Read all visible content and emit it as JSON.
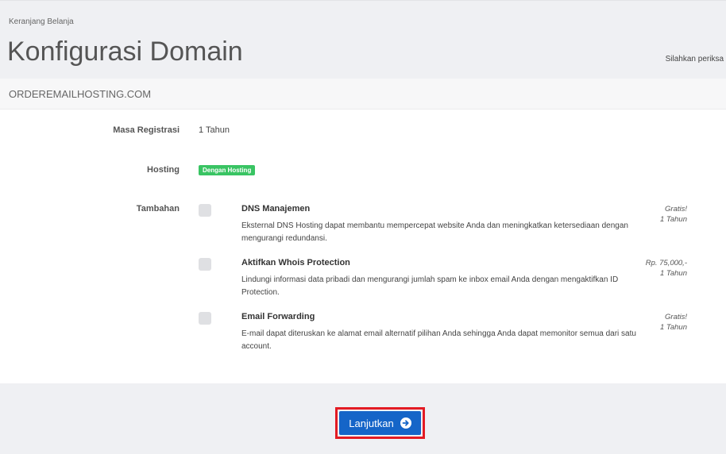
{
  "header": {
    "breadcrumb": "Keranjang Belanja",
    "title": "Konfigurasi Domain",
    "subtitle": "Silahkan periksa"
  },
  "domain": {
    "name": "ORDEREMAILHOSTING.COM"
  },
  "fields": {
    "registration_label": "Masa Registrasi",
    "registration_value": "1 Tahun",
    "hosting_label": "Hosting",
    "hosting_badge": "Dengan Hosting",
    "addons_label": "Tambahan"
  },
  "addons": [
    {
      "title": "DNS Manajemen",
      "description": "Eksternal DNS Hosting dapat membantu mempercepat website Anda dan meningkatkan ketersediaan dengan mengurangi redundansi.",
      "price": "Gratis!",
      "period": "1 Tahun",
      "checked": false
    },
    {
      "title": "Aktifkan Whois Protection",
      "description": "Lindungi informasi data pribadi dan mengurangi jumlah spam ke inbox email Anda dengan mengaktifkan ID Protection.",
      "price": "Rp. 75,000,-",
      "period": "1 Tahun",
      "checked": false
    },
    {
      "title": "Email Forwarding",
      "description": "E-mail dapat diteruskan ke alamat email alternatif pilihan Anda sehingga Anda dapat memonitor semua dari satu account.",
      "price": "Gratis!",
      "period": "1 Tahun",
      "checked": false
    }
  ],
  "actions": {
    "continue_label": "Lanjutkan",
    "continue_icon": "arrow-circle-right-icon"
  },
  "colors": {
    "badge": "#39c463",
    "button": "#1565c8",
    "highlight": "#e31b23"
  }
}
